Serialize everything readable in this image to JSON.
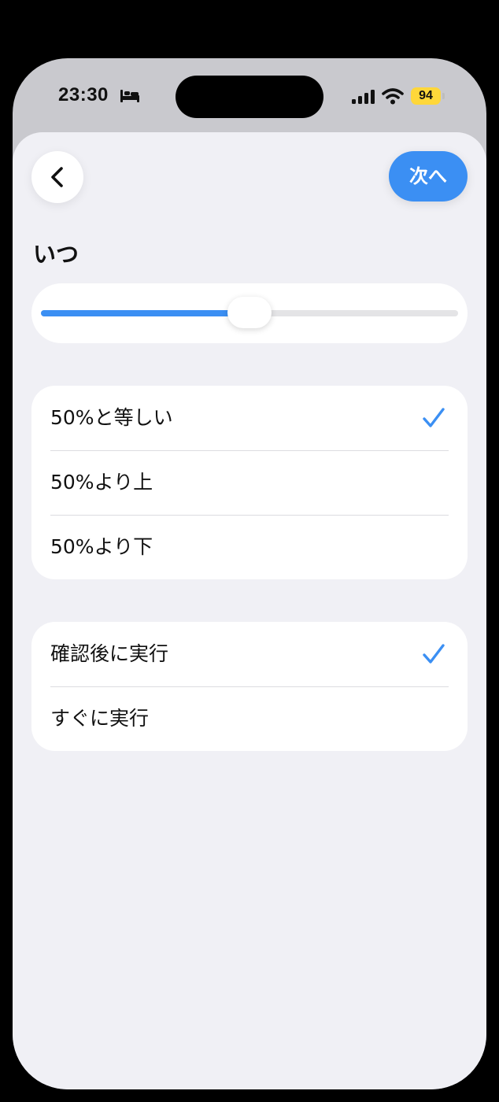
{
  "status_bar": {
    "time": "23:30",
    "battery": "94"
  },
  "header": {
    "next_label": "次へ"
  },
  "section": {
    "title": "いつ"
  },
  "slider": {
    "value_fraction": 0.5
  },
  "condition_options": [
    {
      "label": "50%と等しい",
      "selected": true
    },
    {
      "label": "50%より上",
      "selected": false
    },
    {
      "label": "50%より下",
      "selected": false
    }
  ],
  "run_options": [
    {
      "label": "確認後に実行",
      "selected": true
    },
    {
      "label": "すぐに実行",
      "selected": false
    }
  ],
  "colors": {
    "accent": "#3b8ff3",
    "background": "#f0f0f5",
    "battery": "#ffd73a"
  }
}
